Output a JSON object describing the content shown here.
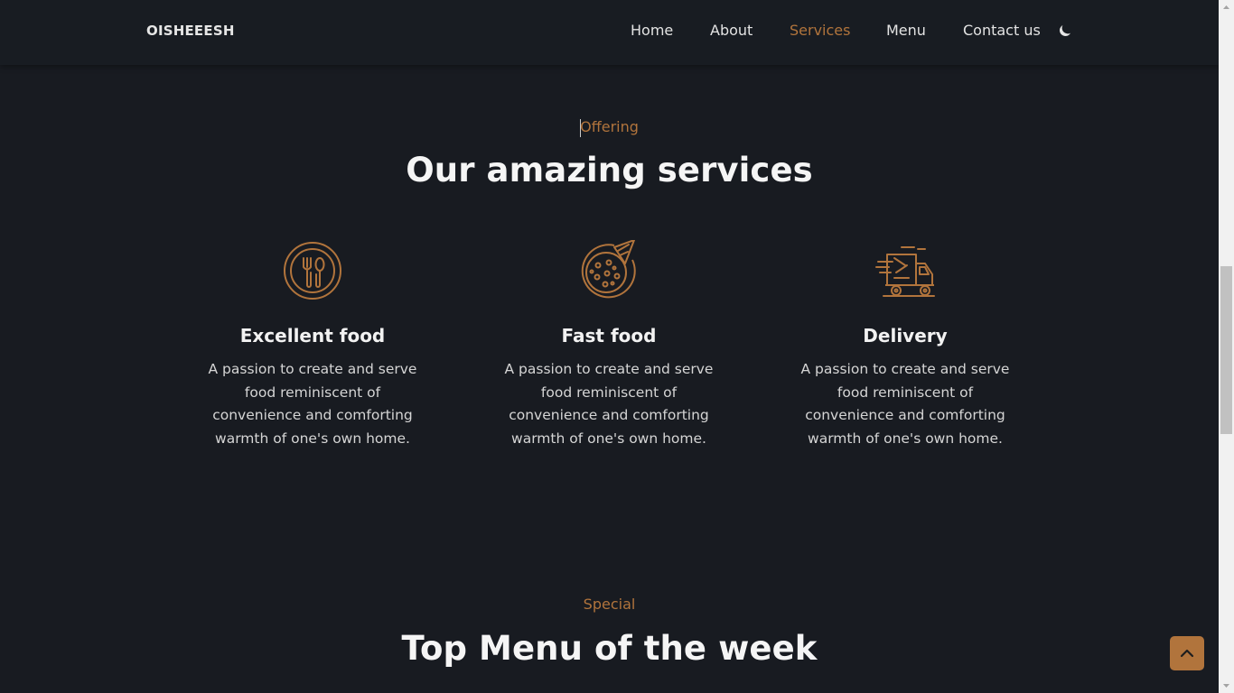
{
  "header": {
    "logo": "OISHEEESH",
    "nav": [
      {
        "label": "Home"
      },
      {
        "label": "About"
      },
      {
        "label": "Services",
        "active": true
      },
      {
        "label": "Menu"
      },
      {
        "label": "Contact us"
      }
    ],
    "theme_icon": "moon-icon"
  },
  "services_section": {
    "eyebrow": "Offering",
    "title": "Our amazing services",
    "items": [
      {
        "icon": "cutlery-plate-icon",
        "title": "Excellent food",
        "description": "A passion to create and serve food reminiscent of convenience and comforting warmth of one's own home."
      },
      {
        "icon": "pizza-icon",
        "title": "Fast food",
        "description": "A passion to create and serve food reminiscent of convenience and comforting warmth of one's own home."
      },
      {
        "icon": "delivery-truck-icon",
        "title": "Delivery",
        "description": "A passion to create and serve food reminiscent of convenience and comforting warmth of one's own home."
      }
    ]
  },
  "menu_section": {
    "eyebrow": "Special",
    "title": "Top Menu of the week"
  },
  "back_to_top_icon": "chevron-up-icon",
  "colors": {
    "accent": "#b1743c",
    "background": "#181b21",
    "text": "#ffffff"
  }
}
